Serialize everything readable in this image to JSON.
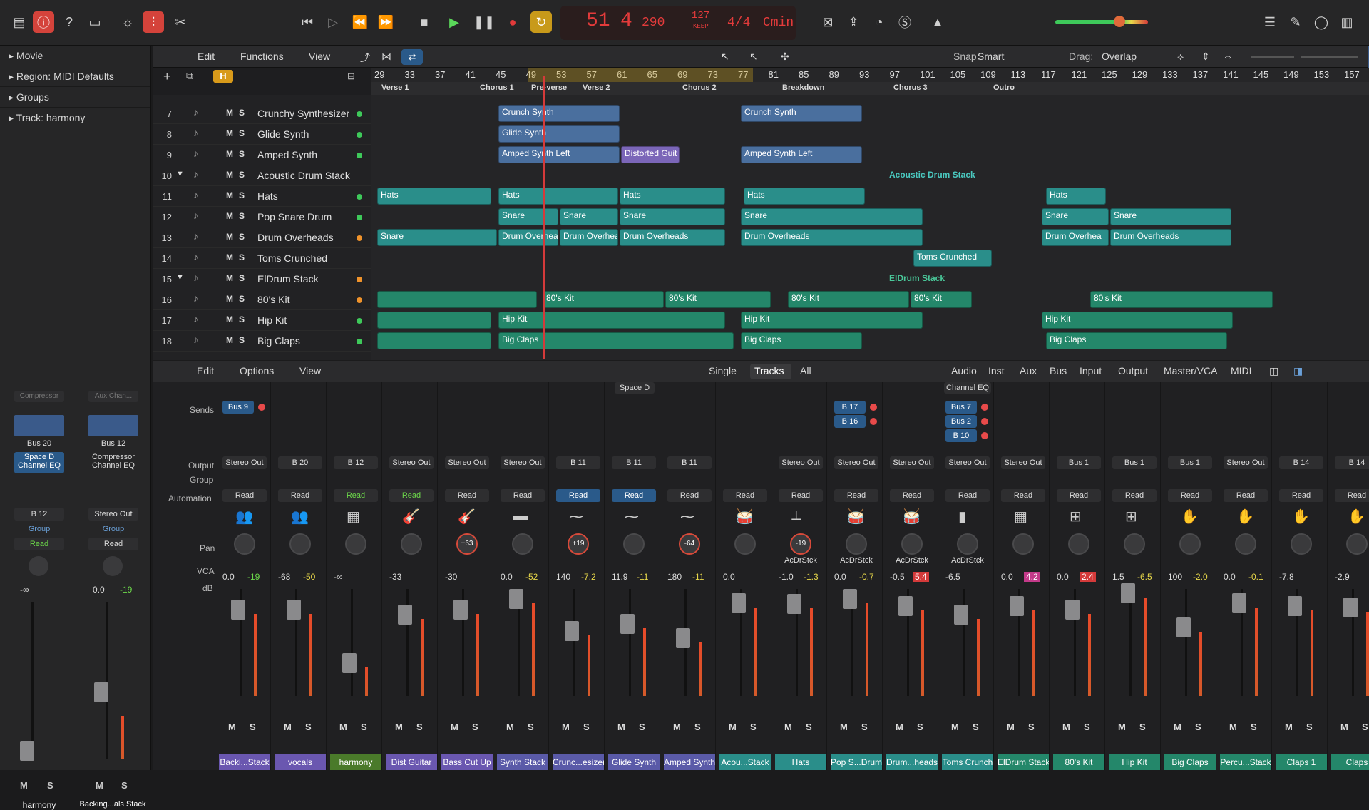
{
  "transport": {
    "bar": "51",
    "beat": "4",
    "div": "290",
    "tempo": "127",
    "tempo_label": "KEEP",
    "signature": "4/4",
    "key": "Cmin"
  },
  "inspector": {
    "items": [
      "Movie",
      "Region: MIDI Defaults",
      "Groups",
      "Track:  harmony"
    ],
    "strips": [
      {
        "setting": "Compressor",
        "sends_label": "Bus 20",
        "eq": "Space D\nChannel EQ",
        "output": "B 12",
        "group": "Group",
        "auto": "Read",
        "db": "-∞",
        "name": "harmony"
      },
      {
        "setting": "Aux Chan...",
        "sends_label": "Bus 12",
        "eq": "Compressor\nChannel EQ",
        "output": "Stereo Out",
        "group": "Group",
        "auto": "Read",
        "db": "0.0",
        "db2": "-19",
        "name": "Backing...als Stack"
      }
    ]
  },
  "arrange": {
    "menus": {
      "edit": "Edit",
      "functions": "Functions",
      "view": "View"
    },
    "snap_label": "Snap:",
    "snap_value": "Smart",
    "drag_label": "Drag:",
    "drag_value": "Overlap",
    "h_badge": "H",
    "ruler": [
      "29",
      "33",
      "37",
      "41",
      "45",
      "49",
      "53",
      "57",
      "61",
      "65",
      "69",
      "73",
      "77",
      "81",
      "85",
      "89",
      "93",
      "97",
      "101",
      "105",
      "109",
      "113",
      "117",
      "121",
      "125",
      "129",
      "133",
      "137",
      "141",
      "145",
      "149",
      "153",
      "157"
    ],
    "markers": [
      {
        "label": "Verse 1"
      },
      {
        "label": "Chorus 1"
      },
      {
        "label": "Pre-verse"
      },
      {
        "label": "Verse 2"
      },
      {
        "label": "Chorus 2"
      },
      {
        "label": "Breakdown"
      },
      {
        "label": "Chorus 3"
      },
      {
        "label": "Outro"
      }
    ],
    "tracks": [
      {
        "num": "7",
        "name": "Crunchy Synthesizer",
        "dot": "#3ec95a"
      },
      {
        "num": "8",
        "name": "Glide Synth",
        "dot": "#3ec95a"
      },
      {
        "num": "9",
        "name": "Amped Synth",
        "dot": "#3ec95a"
      },
      {
        "num": "10",
        "name": "Acoustic Drum Stack",
        "dot": ""
      },
      {
        "num": "11",
        "name": "Hats",
        "dot": "#3ec95a"
      },
      {
        "num": "12",
        "name": "Pop Snare Drum",
        "dot": "#3ec95a"
      },
      {
        "num": "13",
        "name": "Drum Overheads",
        "dot": "#f0932b"
      },
      {
        "num": "14",
        "name": "Toms Crunched",
        "dot": ""
      },
      {
        "num": "15",
        "name": "ElDrum Stack",
        "dot": "#f0932b"
      },
      {
        "num": "16",
        "name": "80's Kit",
        "dot": "#f0932b"
      },
      {
        "num": "17",
        "name": "Hip Kit",
        "dot": "#3ec95a"
      },
      {
        "num": "18",
        "name": "Big Claps",
        "dot": "#3ec95a"
      }
    ],
    "stack_labels": {
      "acoustic": "Acoustic Drum Stack",
      "eldrum": "ElDrum Stack"
    },
    "regions": {
      "crunch": "Crunch Synth",
      "glide": "Glide Synth",
      "amped_left": "Amped Synth Left",
      "distorted": "Distorted Guit",
      "hats": "Hats",
      "snare": "Snare",
      "overheads": "Drum Overheads",
      "overheads_short": "Drum Overhea",
      "toms": "Toms Crunched",
      "kit80": "80's Kit",
      "hipkit": "Hip Kit",
      "claps": "Big Claps"
    }
  },
  "mixer": {
    "menus": {
      "edit": "Edit",
      "options": "Options",
      "view": "View"
    },
    "modes": [
      "Single",
      "Tracks",
      "All"
    ],
    "filters": [
      "Audio",
      "Inst",
      "Aux",
      "Bus",
      "Input",
      "Output",
      "Master/VCA",
      "MIDI"
    ],
    "row_labels": {
      "sends": "Sends",
      "output": "Output",
      "group": "Group",
      "automation": "Automation",
      "pan": "Pan",
      "vca": "VCA",
      "db": "dB"
    },
    "top_labels": {
      "space_d": "Space D",
      "channel_eq": "Channel EQ"
    },
    "channels": [
      {
        "name": "Backi...Stack",
        "color": "#6a57b0",
        "sends": [
          "Bus 9"
        ],
        "output": "Stereo Out",
        "auto": "Read",
        "auto_style": "",
        "icon": "👥",
        "pan": "",
        "vca": "",
        "db": "0.0",
        "db2": "-19",
        "db2_color": "#6cd84a"
      },
      {
        "name": "vocals",
        "color": "#6a57b0",
        "sends": [],
        "output": "B 20",
        "auto": "Read",
        "auto_style": "",
        "icon": "👥",
        "pan": "",
        "vca": "",
        "db": "-68",
        "db2": "-50",
        "db2_color": "#e8d84a"
      },
      {
        "name": "harmony",
        "color": "#4a7a2a",
        "sends": [],
        "output": "B 12",
        "auto": "Read",
        "auto_style": "green",
        "icon": "▦",
        "pan": "",
        "vca": "",
        "db": "-∞",
        "db2": "",
        "db2_color": ""
      },
      {
        "name": "Dist Guitar",
        "color": "#6a57b0",
        "sends": [],
        "output": "Stereo Out",
        "auto": "Read",
        "auto_style": "green",
        "icon": "🎸",
        "pan": "",
        "vca": "",
        "db": "-33",
        "db2": "",
        "db2_color": ""
      },
      {
        "name": "Bass Cut Up",
        "color": "#6a57b0",
        "sends": [],
        "output": "Stereo Out",
        "auto": "Read",
        "auto_style": "",
        "icon": "🎸",
        "pan": "+63",
        "vca": "",
        "db": "-30",
        "db2": "",
        "db2_color": ""
      },
      {
        "name": "Synth Stack",
        "color": "#5a5aa8",
        "sends": [],
        "output": "Stereo Out",
        "auto": "Read",
        "auto_style": "",
        "icon": "▬",
        "pan": "",
        "vca": "",
        "db": "0.0",
        "db2": "-52",
        "db2_color": "#e8d84a"
      },
      {
        "name": "Crunc...esizer",
        "color": "#5a5aa8",
        "sends": [],
        "output": "B 11",
        "auto": "Read",
        "auto_style": "blue",
        "icon": "⁓",
        "pan": "+19",
        "vca": "",
        "db": "140",
        "db2": "-7.2",
        "db2_color": "#e8d84a"
      },
      {
        "name": "Glide Synth",
        "color": "#5a5aa8",
        "sends": [],
        "output": "B 11",
        "auto": "Read",
        "auto_style": "blue",
        "icon": "⁓",
        "pan": "",
        "vca": "",
        "db": "11.9",
        "db2": "-11",
        "db2_color": "#e8d84a"
      },
      {
        "name": "Amped Synth",
        "color": "#5a5aa8",
        "sends": [],
        "output": "B 11",
        "auto": "Read",
        "auto_style": "",
        "icon": "⁓",
        "pan": "-64",
        "vca": "",
        "db": "180",
        "db2": "-11",
        "db2_color": "#e8d84a"
      },
      {
        "name": "Acou...Stack",
        "color": "#2a8e8a",
        "sends": [],
        "output": "",
        "auto": "Read",
        "auto_style": "",
        "icon": "🥁",
        "pan": "",
        "vca": "",
        "db": "0.0",
        "db2": "",
        "db2_color": ""
      },
      {
        "name": "Hats",
        "color": "#2a8e8a",
        "sends": [],
        "output": "Stereo Out",
        "auto": "Read",
        "auto_style": "",
        "icon": "⟂",
        "pan": "-19",
        "vca": "AcDrStck",
        "db": "-1.0",
        "db2": "-1.3",
        "db2_color": "#e8d84a"
      },
      {
        "name": "Pop S...Drum",
        "color": "#2a8e8a",
        "sends": [
          "B 17",
          "B 16"
        ],
        "output": "Stereo Out",
        "auto": "Read",
        "auto_style": "",
        "icon": "🥁",
        "pan": "",
        "vca": "AcDrStck",
        "db": "0.0",
        "db2": "-0.7",
        "db2_color": "#e8d84a"
      },
      {
        "name": "Drum...heads",
        "color": "#2a8e8a",
        "sends": [],
        "output": "Stereo Out",
        "auto": "Read",
        "auto_style": "",
        "icon": "🥁",
        "pan": "",
        "vca": "AcDrStck",
        "db": "-0.5",
        "db2": "5.4",
        "db2_color": "#d43a3a"
      },
      {
        "name": "Toms Crunch",
        "color": "#2a8e8a",
        "sends": [
          "Bus 7",
          "Bus 2",
          "B 10"
        ],
        "output": "Stereo Out",
        "auto": "Read",
        "auto_style": "",
        "icon": "▮",
        "pan": "",
        "vca": "AcDrStck",
        "db": "-6.5",
        "db2": "",
        "db2_color": ""
      },
      {
        "name": "ElDrum Stack",
        "color": "#24876a",
        "sends": [],
        "output": "Stereo Out",
        "auto": "Read",
        "auto_style": "",
        "icon": "▦",
        "pan": "",
        "vca": "",
        "db": "0.0",
        "db2": "4.2",
        "db2_color": "#c43a8a"
      },
      {
        "name": "80's Kit",
        "color": "#24876a",
        "sends": [],
        "output": "Bus 1",
        "auto": "Read",
        "auto_style": "",
        "icon": "⊞",
        "pan": "",
        "vca": "",
        "db": "0.0",
        "db2": "2.4",
        "db2_color": "#d43a3a"
      },
      {
        "name": "Hip Kit",
        "color": "#24876a",
        "sends": [],
        "output": "Bus 1",
        "auto": "Read",
        "auto_style": "",
        "icon": "⊞",
        "pan": "",
        "vca": "",
        "db": "1.5",
        "db2": "-6.5",
        "db2_color": "#e8d84a"
      },
      {
        "name": "Big Claps",
        "color": "#24876a",
        "sends": [],
        "output": "Bus 1",
        "auto": "Read",
        "auto_style": "",
        "icon": "✋",
        "pan": "",
        "vca": "",
        "db": "100",
        "db2": "-2.0",
        "db2_color": "#e8d84a"
      },
      {
        "name": "Percu...Stack",
        "color": "#24876a",
        "sends": [],
        "output": "Stereo Out",
        "auto": "Read",
        "auto_style": "",
        "icon": "✋",
        "pan": "",
        "vca": "",
        "db": "0.0",
        "db2": "-0.1",
        "db2_color": "#e8d84a"
      },
      {
        "name": "Claps 1",
        "color": "#24876a",
        "sends": [],
        "output": "B 14",
        "auto": "Read",
        "auto_style": "",
        "icon": "✋",
        "pan": "",
        "vca": "",
        "db": "-7.8",
        "db2": "",
        "db2_color": ""
      },
      {
        "name": "Claps",
        "color": "#24876a",
        "sends": [],
        "output": "B 14",
        "auto": "Read",
        "auto_style": "",
        "icon": "✋",
        "pan": "",
        "vca": "",
        "db": "-2.9",
        "db2": "",
        "db2_color": ""
      }
    ]
  }
}
